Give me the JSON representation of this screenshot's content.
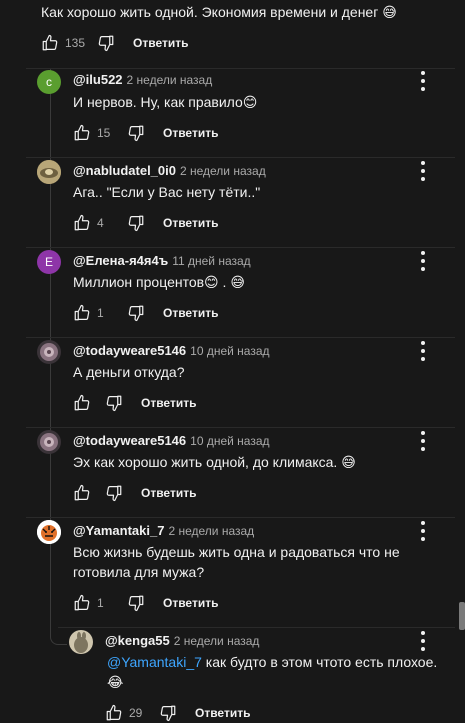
{
  "top": {
    "text": "Как хорошо жить одной. Экономия времени и денег 😅",
    "likes": "135",
    "reply_label": "Ответить"
  },
  "comments": [
    {
      "author": "@ilu522",
      "time": "2 недели назад",
      "avatar_letter": "c",
      "avatar_color": "#5a9e2f",
      "text": "И нервов. Ну, как правило😊",
      "likes": "15",
      "reply_label": "Ответить"
    },
    {
      "author": "@nabludatel_0i0",
      "time": "2 недели назад",
      "avatar_color": "#9c8a55",
      "text": "Ага.. \"Если у Вас нету тёти..\"",
      "likes": "4",
      "reply_label": "Ответить"
    },
    {
      "author": "@Елена-я4я4ъ",
      "time": "11 дней назад",
      "avatar_letter": "E",
      "avatar_color": "#8e35a8",
      "text": "Миллион процентов😊 . 😅",
      "likes": "1",
      "reply_label": "Ответить"
    },
    {
      "author": "@todayweare5146",
      "time": "10 дней назад",
      "avatar_color": "#6a5560",
      "text": "А деньги откуда?",
      "likes": "",
      "reply_label": "Ответить"
    },
    {
      "author": "@todayweare5146",
      "time": "10 дней назад",
      "avatar_color": "#6a5560",
      "text": "Эх как хорошо жить одной, до климакса. 😅",
      "likes": "",
      "reply_label": "Ответить"
    },
    {
      "author": "@Yamantaki_7",
      "time": "2 недели назад",
      "avatar_color": "#ffffff",
      "text_line1": "Всю жизнь будешь жить одна и радоваться что не",
      "text_line2": "готовила для мужа?",
      "likes": "1",
      "reply_label": "Ответить"
    }
  ],
  "nested": {
    "author": "@kenga55",
    "time": "2 недели назад",
    "avatar_color": "#7d7560",
    "mention": "@Yamantaki_7",
    "text_rest": " как будто в этом чтото есть плохое.",
    "text_line2": "😂",
    "likes": "29",
    "reply_label": "Ответить"
  },
  "icons": {
    "like": "thumb-up-icon",
    "dislike": "thumb-down-icon",
    "menu": "more-vertical-icon"
  }
}
